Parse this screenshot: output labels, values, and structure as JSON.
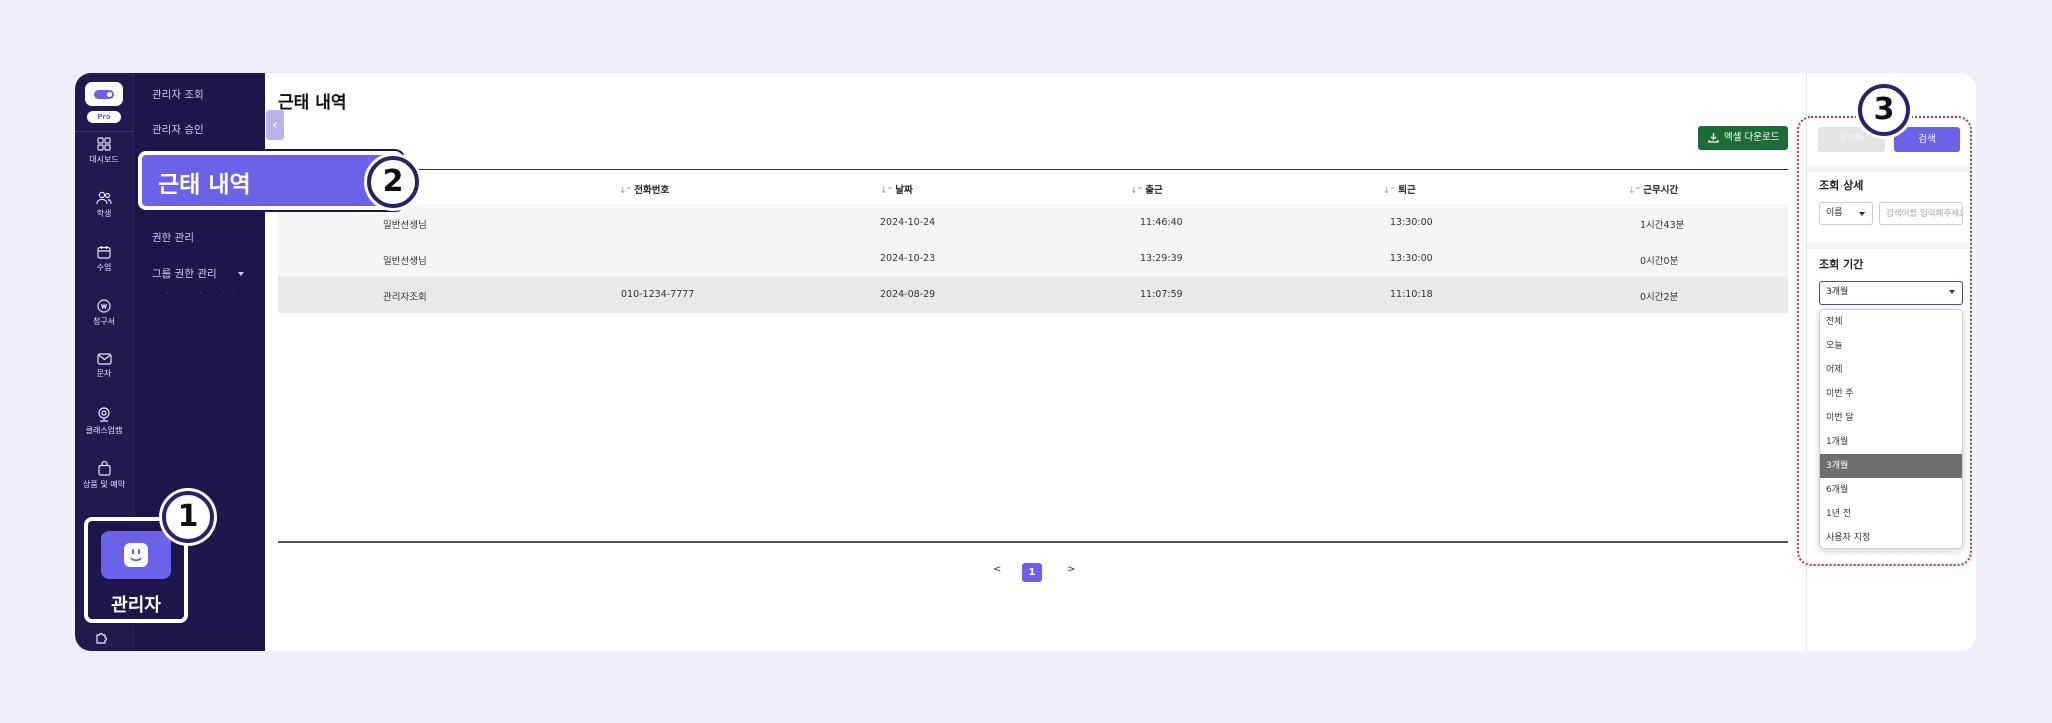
{
  "rail": {
    "pro_label": "Pro",
    "items": [
      {
        "label": "대시보드",
        "icon": "grid-icon"
      },
      {
        "label": "학생",
        "icon": "users-icon"
      },
      {
        "label": "수업",
        "icon": "calendar-icon"
      },
      {
        "label": "청구서",
        "icon": "coin-icon"
      },
      {
        "label": "문자",
        "icon": "mail-icon"
      },
      {
        "label": "클래스업캠",
        "icon": "webcam-icon"
      },
      {
        "label": "상품 및 예약",
        "icon": "bag-icon"
      }
    ],
    "admin_label": "관리자"
  },
  "submenu": {
    "items": [
      "관리자 조회",
      "관리자 승인",
      "권한 관리",
      "그룹 권한 관리"
    ],
    "active": "근태 내역"
  },
  "main": {
    "title": "근태 내역",
    "excel_button": "엑셀 다운로드",
    "columns": [
      "전화번호",
      "날짜",
      "출근",
      "퇴근",
      "근무시간"
    ],
    "rows": [
      {
        "name": "일반선생님",
        "phone": "",
        "date": "2024-10-24",
        "in": "11:46:40",
        "out": "13:30:00",
        "hours": "1시간43분"
      },
      {
        "name": "일반선생님",
        "phone": "",
        "date": "2024-10-23",
        "in": "13:29:39",
        "out": "13:30:00",
        "hours": "0시간0분"
      },
      {
        "name": "관리자조회",
        "phone": "010-1234-7777",
        "date": "2024-08-29",
        "in": "11:07:59",
        "out": "11:10:18",
        "hours": "0시간2분"
      }
    ],
    "pager": {
      "prev": "<",
      "current": "1",
      "next": ">"
    }
  },
  "panel": {
    "reset_button": "초기화",
    "search_button": "검색",
    "detail_label": "조회 상세",
    "detail_select": "이름",
    "search_placeholder": "검색어를 입력해주세요",
    "period_label": "조회 기간",
    "period_value": "3개월",
    "options": [
      "전체",
      "오늘",
      "어제",
      "이번 주",
      "이번 달",
      "1개월",
      "3개월",
      "6개월",
      "1년 전",
      "사용자 지정"
    ],
    "selected_option": "3개월"
  },
  "badges": [
    "1",
    "2",
    "3"
  ],
  "colors": {
    "accent": "#6b62e8",
    "sidebar": "#1d164a",
    "excel": "#1e6b3a",
    "highlight_border": "#d42a2a"
  }
}
